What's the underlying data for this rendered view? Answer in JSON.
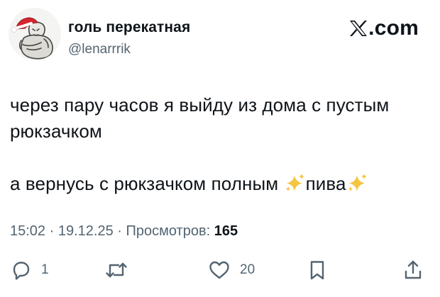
{
  "author": {
    "display_name": "голь перекатная",
    "handle": "@lenarrrik"
  },
  "brand": {
    "name": ".com",
    "icon": "x-logo-icon"
  },
  "tweet": {
    "line1": "через пару часов я выйду из дома с пустым",
    "line2": "рюкзачком",
    "line3_a": "а вернусь с рюкзачком полным ",
    "line3_b": "пива"
  },
  "meta": {
    "time": "15:02",
    "date": "19.12.25",
    "views_label": "Просмотров:",
    "views_count": "165"
  },
  "actions": {
    "reply_count": "1",
    "like_count": "20"
  },
  "icons": [
    "reply-icon",
    "retweet-icon",
    "like-icon",
    "bookmark-icon",
    "share-icon",
    "sparkles-icon"
  ],
  "colors": {
    "text": "#0f1419",
    "muted": "#536471",
    "sparkle": "#f4c542"
  }
}
